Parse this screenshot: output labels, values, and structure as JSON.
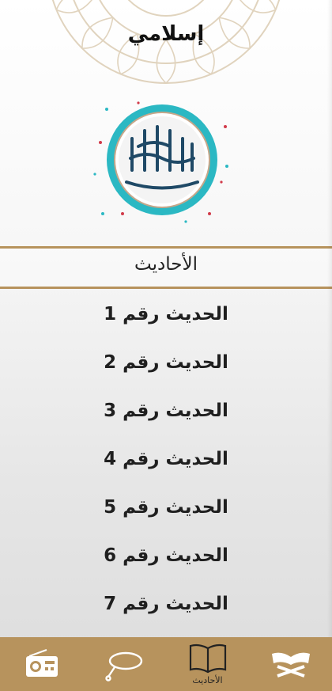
{
  "header": {
    "title": "إسلامي"
  },
  "section": {
    "title": "الأحاديث"
  },
  "hadith_list": [
    "الحديث رقم 1",
    "الحديث رقم 2",
    "الحديث رقم 3",
    "الحديث رقم 4",
    "الحديث رقم 5",
    "الحديث رقم 6",
    "الحديث رقم 7"
  ],
  "bottom_nav": {
    "items": [
      {
        "icon": "radio-icon",
        "label": ""
      },
      {
        "icon": "tasbeeh-icon",
        "label": ""
      },
      {
        "icon": "book-icon",
        "label": "الأحاديث",
        "active": true
      },
      {
        "icon": "quran-icon",
        "label": ""
      }
    ]
  },
  "colors": {
    "accent": "#b7935d",
    "logo_teal": "#2bb8c3",
    "logo_text": "#1f4966"
  }
}
